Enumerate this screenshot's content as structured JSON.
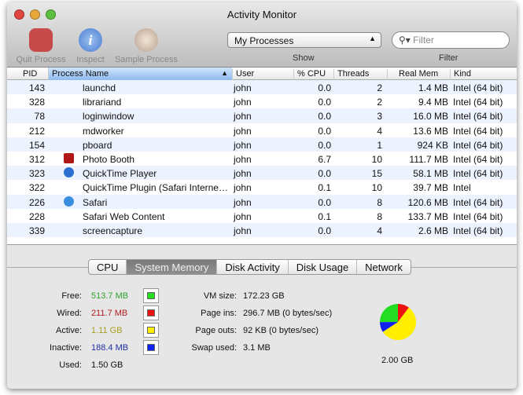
{
  "window": {
    "title": "Activity Monitor"
  },
  "toolbar": {
    "quit": "Quit Process",
    "inspect": "Inspect",
    "sample": "Sample Process",
    "show_value": "My Processes",
    "show_label": "Show",
    "filter_placeholder": "Filter",
    "filter_label": "Filter"
  },
  "columns": [
    "PID",
    "Process Name",
    "User",
    "% CPU",
    "Threads",
    "Real Mem",
    "Kind"
  ],
  "rows": [
    {
      "pid": "143",
      "name": "launchd",
      "user": "john",
      "cpu": "0.0",
      "threads": "2",
      "mem": "1.4 MB",
      "kind": "Intel (64 bit)",
      "icon": ""
    },
    {
      "pid": "328",
      "name": "librariand",
      "user": "john",
      "cpu": "0.0",
      "threads": "2",
      "mem": "9.4 MB",
      "kind": "Intel (64 bit)",
      "icon": ""
    },
    {
      "pid": "78",
      "name": "loginwindow",
      "user": "john",
      "cpu": "0.0",
      "threads": "3",
      "mem": "16.0 MB",
      "kind": "Intel (64 bit)",
      "icon": ""
    },
    {
      "pid": "212",
      "name": "mdworker",
      "user": "john",
      "cpu": "0.0",
      "threads": "4",
      "mem": "13.6 MB",
      "kind": "Intel (64 bit)",
      "icon": ""
    },
    {
      "pid": "154",
      "name": "pboard",
      "user": "john",
      "cpu": "0.0",
      "threads": "1",
      "mem": "924 KB",
      "kind": "Intel (64 bit)",
      "icon": ""
    },
    {
      "pid": "312",
      "name": "Photo Booth",
      "user": "john",
      "cpu": "6.7",
      "threads": "10",
      "mem": "111.7 MB",
      "kind": "Intel (64 bit)",
      "icon": "photo-booth"
    },
    {
      "pid": "323",
      "name": "QuickTime Player",
      "user": "john",
      "cpu": "0.0",
      "threads": "15",
      "mem": "58.1 MB",
      "kind": "Intel (64 bit)",
      "icon": "quicktime"
    },
    {
      "pid": "322",
      "name": "QuickTime Plugin (Safari Interne…",
      "user": "john",
      "cpu": "0.1",
      "threads": "10",
      "mem": "39.7 MB",
      "kind": "Intel",
      "icon": ""
    },
    {
      "pid": "226",
      "name": "Safari",
      "user": "john",
      "cpu": "0.0",
      "threads": "8",
      "mem": "120.6 MB",
      "kind": "Intel (64 bit)",
      "icon": "safari"
    },
    {
      "pid": "228",
      "name": "Safari Web Content",
      "user": "john",
      "cpu": "0.1",
      "threads": "8",
      "mem": "133.7 MB",
      "kind": "Intel (64 bit)",
      "icon": ""
    },
    {
      "pid": "339",
      "name": "screencapture",
      "user": "john",
      "cpu": "0.0",
      "threads": "4",
      "mem": "2.6 MB",
      "kind": "Intel (64 bit)",
      "icon": ""
    }
  ],
  "tabs": [
    "CPU",
    "System Memory",
    "Disk Activity",
    "Disk Usage",
    "Network"
  ],
  "active_tab": 1,
  "memory": [
    {
      "label": "Free:",
      "value": "513.7 MB",
      "color": "#2fa12f",
      "swatch": "#22dd22",
      "mb": 513.7
    },
    {
      "label": "Wired:",
      "value": "211.7 MB",
      "color": "#b02020",
      "swatch": "#ee1111",
      "mb": 211.7
    },
    {
      "label": "Active:",
      "value": "1.11 GB",
      "color": "#a8a020",
      "swatch": "#ffee00",
      "mb": 1136.6
    },
    {
      "label": "Inactive:",
      "value": "188.4 MB",
      "color": "#2030a0",
      "swatch": "#1122ee",
      "mb": 188.4
    }
  ],
  "used": {
    "label": "Used:",
    "value": "1.50 GB"
  },
  "vm": [
    {
      "label": "VM size:",
      "value": "172.23 GB"
    },
    {
      "label": "Page ins:",
      "value": "296.7 MB (0 bytes/sec)"
    },
    {
      "label": "Page outs:",
      "value": "92 KB (0 bytes/sec)"
    },
    {
      "label": "Swap used:",
      "value": "3.1 MB"
    }
  ],
  "total": "2.00 GB"
}
